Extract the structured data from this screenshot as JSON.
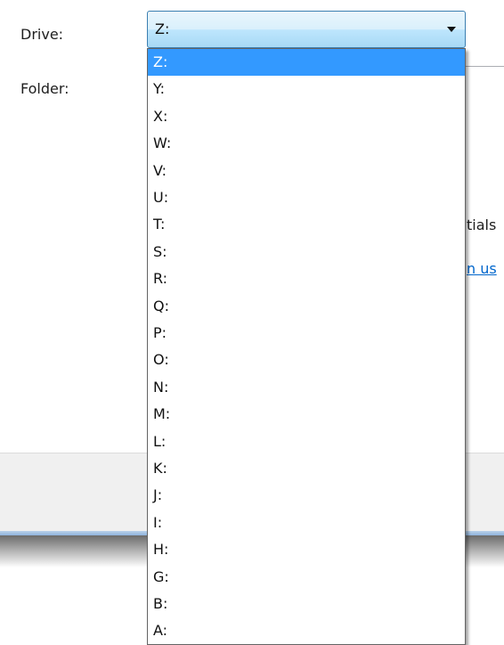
{
  "form": {
    "drive_label": "Drive:",
    "folder_label": "Folder:",
    "drive_selected": "Z:",
    "peek_text": "tials",
    "peek_link": "n us"
  },
  "dropdown": {
    "selected_index": 0,
    "options": [
      {
        "label": "Z:"
      },
      {
        "label": "Y:"
      },
      {
        "label": "X:"
      },
      {
        "label": "W:"
      },
      {
        "label": "V:"
      },
      {
        "label": "U:"
      },
      {
        "label": "T:"
      },
      {
        "label": "S:"
      },
      {
        "label": "R:"
      },
      {
        "label": "Q:"
      },
      {
        "label": "P:"
      },
      {
        "label": "O:"
      },
      {
        "label": "N:"
      },
      {
        "label": "M:"
      },
      {
        "label": "L:"
      },
      {
        "label": "K:"
      },
      {
        "label": "J:"
      },
      {
        "label": "I:"
      },
      {
        "label": "H:"
      },
      {
        "label": "G:"
      },
      {
        "label": "B:"
      },
      {
        "label": "A:"
      }
    ]
  },
  "colors": {
    "selection": "#3399ff",
    "link": "#0066cc"
  },
  "icons": {
    "combo_arrow": "chevron-down-icon"
  }
}
